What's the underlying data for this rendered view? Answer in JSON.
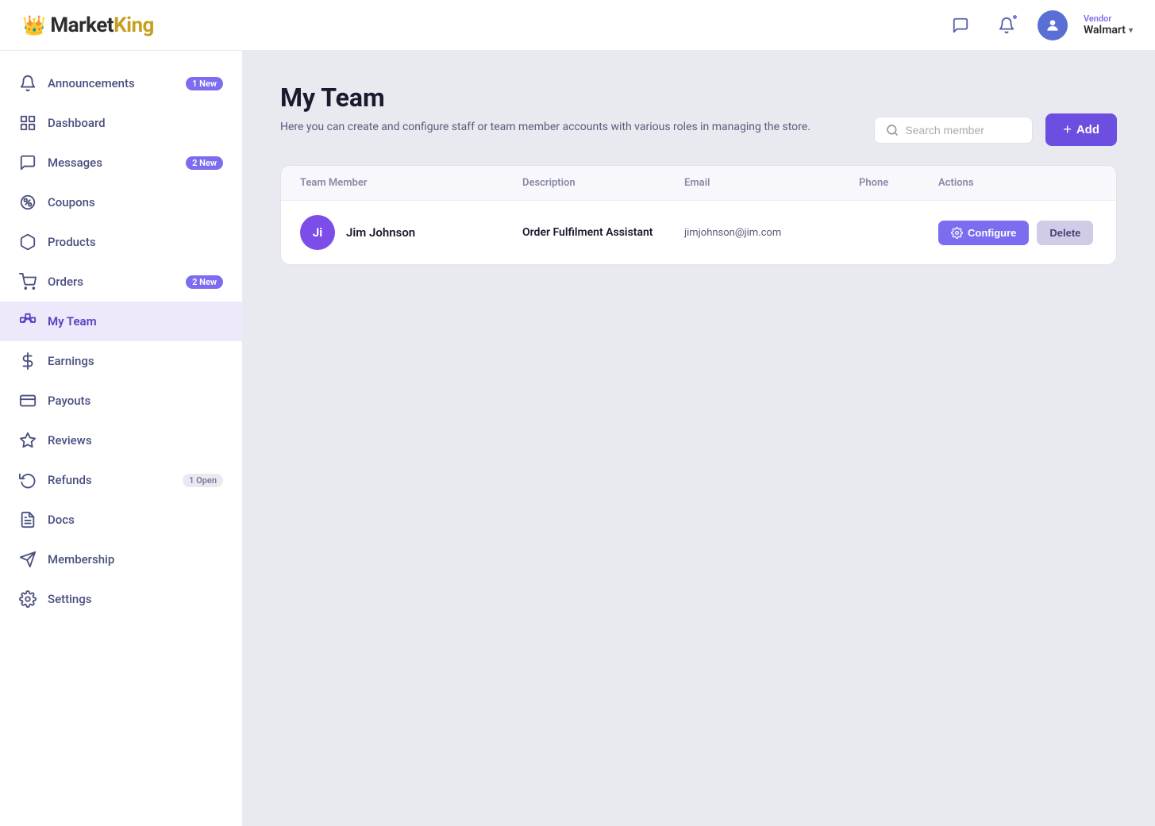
{
  "header": {
    "logo_market": "Market",
    "logo_king": "King",
    "chat_icon": "chat-icon",
    "bell_icon": "bell-icon",
    "vendor_label": "Vendor",
    "vendor_name": "Walmart"
  },
  "sidebar": {
    "items": [
      {
        "id": "announcements",
        "label": "Announcements",
        "badge": "1 New",
        "badge_type": "purple",
        "active": false
      },
      {
        "id": "dashboard",
        "label": "Dashboard",
        "badge": "",
        "badge_type": "",
        "active": false
      },
      {
        "id": "messages",
        "label": "Messages",
        "badge": "2 New",
        "badge_type": "purple",
        "active": false
      },
      {
        "id": "coupons",
        "label": "Coupons",
        "badge": "",
        "badge_type": "",
        "active": false
      },
      {
        "id": "products",
        "label": "Products",
        "badge": "",
        "badge_type": "",
        "active": false
      },
      {
        "id": "orders",
        "label": "Orders",
        "badge": "2 New",
        "badge_type": "purple",
        "active": false
      },
      {
        "id": "my-team",
        "label": "My Team",
        "badge": "",
        "badge_type": "",
        "active": true
      },
      {
        "id": "earnings",
        "label": "Earnings",
        "badge": "",
        "badge_type": "",
        "active": false
      },
      {
        "id": "payouts",
        "label": "Payouts",
        "badge": "",
        "badge_type": "",
        "active": false
      },
      {
        "id": "reviews",
        "label": "Reviews",
        "badge": "",
        "badge_type": "",
        "active": false
      },
      {
        "id": "refunds",
        "label": "Refunds",
        "badge": "1 Open",
        "badge_type": "light",
        "active": false
      },
      {
        "id": "docs",
        "label": "Docs",
        "badge": "",
        "badge_type": "",
        "active": false
      },
      {
        "id": "membership",
        "label": "Membership",
        "badge": "",
        "badge_type": "",
        "active": false
      },
      {
        "id": "settings",
        "label": "Settings",
        "badge": "",
        "badge_type": "",
        "active": false
      }
    ]
  },
  "page": {
    "title": "My Team",
    "description": "Here you can create and configure staff or team member accounts with various roles in managing the store."
  },
  "search": {
    "placeholder": "Search member"
  },
  "add_button": {
    "label": "Add"
  },
  "table": {
    "headers": [
      "Team Member",
      "Description",
      "Email",
      "Phone",
      "Actions"
    ],
    "rows": [
      {
        "initials": "Ji",
        "name": "Jim Johnson",
        "description": "Order Fulfilment Assistant",
        "email": "jimjohnson@jim.com",
        "phone": "",
        "configure_label": "Configure",
        "delete_label": "Delete"
      }
    ]
  }
}
